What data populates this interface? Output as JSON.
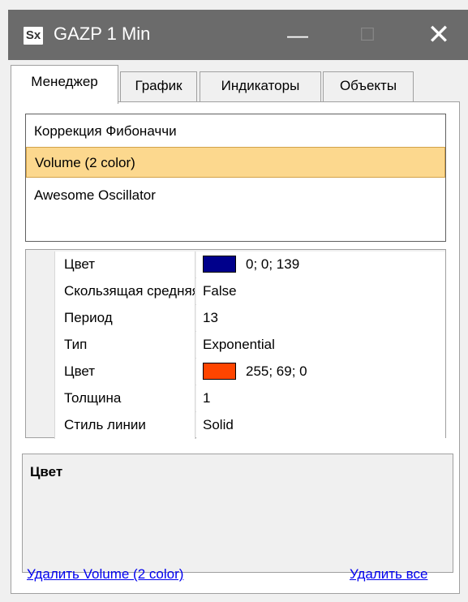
{
  "window": {
    "title": "GAZP 1 Min",
    "logo_text": "Sx",
    "minimize_icon": "—",
    "maximize_icon": "☐",
    "close_icon": "✕"
  },
  "tabs": [
    {
      "label": "Менеджер",
      "active": true
    },
    {
      "label": "График",
      "active": false
    },
    {
      "label": "Индикаторы",
      "active": false
    },
    {
      "label": "Объекты",
      "active": false
    }
  ],
  "indicators": [
    {
      "label": "Коррекция Фибоначчи",
      "selected": false
    },
    {
      "label": "Volume (2 color)",
      "selected": true
    },
    {
      "label": "Awesome Oscillator",
      "selected": false
    }
  ],
  "properties": [
    {
      "name": "Цвет",
      "value": "0; 0; 139",
      "swatch": "#00008b"
    },
    {
      "name": "Скользящая средняя",
      "value": "False",
      "swatch": null
    },
    {
      "name": "Период",
      "value": "13",
      "swatch": null
    },
    {
      "name": "Тип",
      "value": "Exponential",
      "swatch": null
    },
    {
      "name": "Цвет",
      "value": "255; 69; 0",
      "swatch": "#ff4500"
    },
    {
      "name": "Толщина",
      "value": "1",
      "swatch": null
    },
    {
      "name": "Стиль линии",
      "value": "Solid",
      "swatch": null
    }
  ],
  "description": {
    "title": "Цвет"
  },
  "links": {
    "remove": "Удалить Volume (2 color)",
    "remove_all": "Удалить все"
  },
  "colors": {
    "titlebar": "#6b6b6b",
    "selection": "#fcd88e",
    "link": "#0000ee"
  }
}
